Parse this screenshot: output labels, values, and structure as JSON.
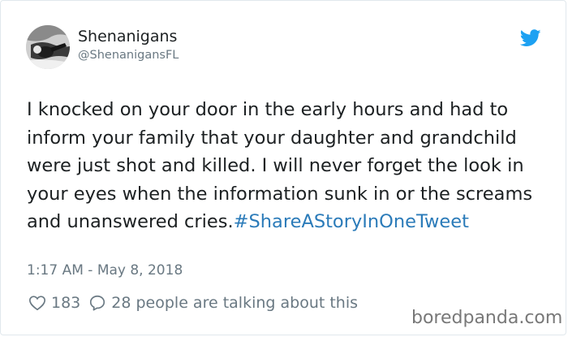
{
  "tweet": {
    "display_name": "Shenanigans",
    "handle": "@ShenanigansFL",
    "text": "I knocked on your door in the early hours and had to inform your family that your daughter and grandchild were just shot and killed. I will never forget the look in your eyes when the information sunk in or the screams and unanswered cries.",
    "hashtag": "#ShareAStoryInOneTweet",
    "timestamp": "1:17 AM - May 8, 2018",
    "like_count": "183",
    "talking_text": "28 people are talking about this"
  },
  "watermark": "boredpanda.com",
  "colors": {
    "hashtag": "#2b7bb9",
    "twitter_blue": "#1da1f2",
    "secondary_text": "#697882"
  },
  "icons": {
    "logo": "twitter-bird-icon",
    "like": "heart-icon",
    "reply": "speech-bubble-icon"
  }
}
